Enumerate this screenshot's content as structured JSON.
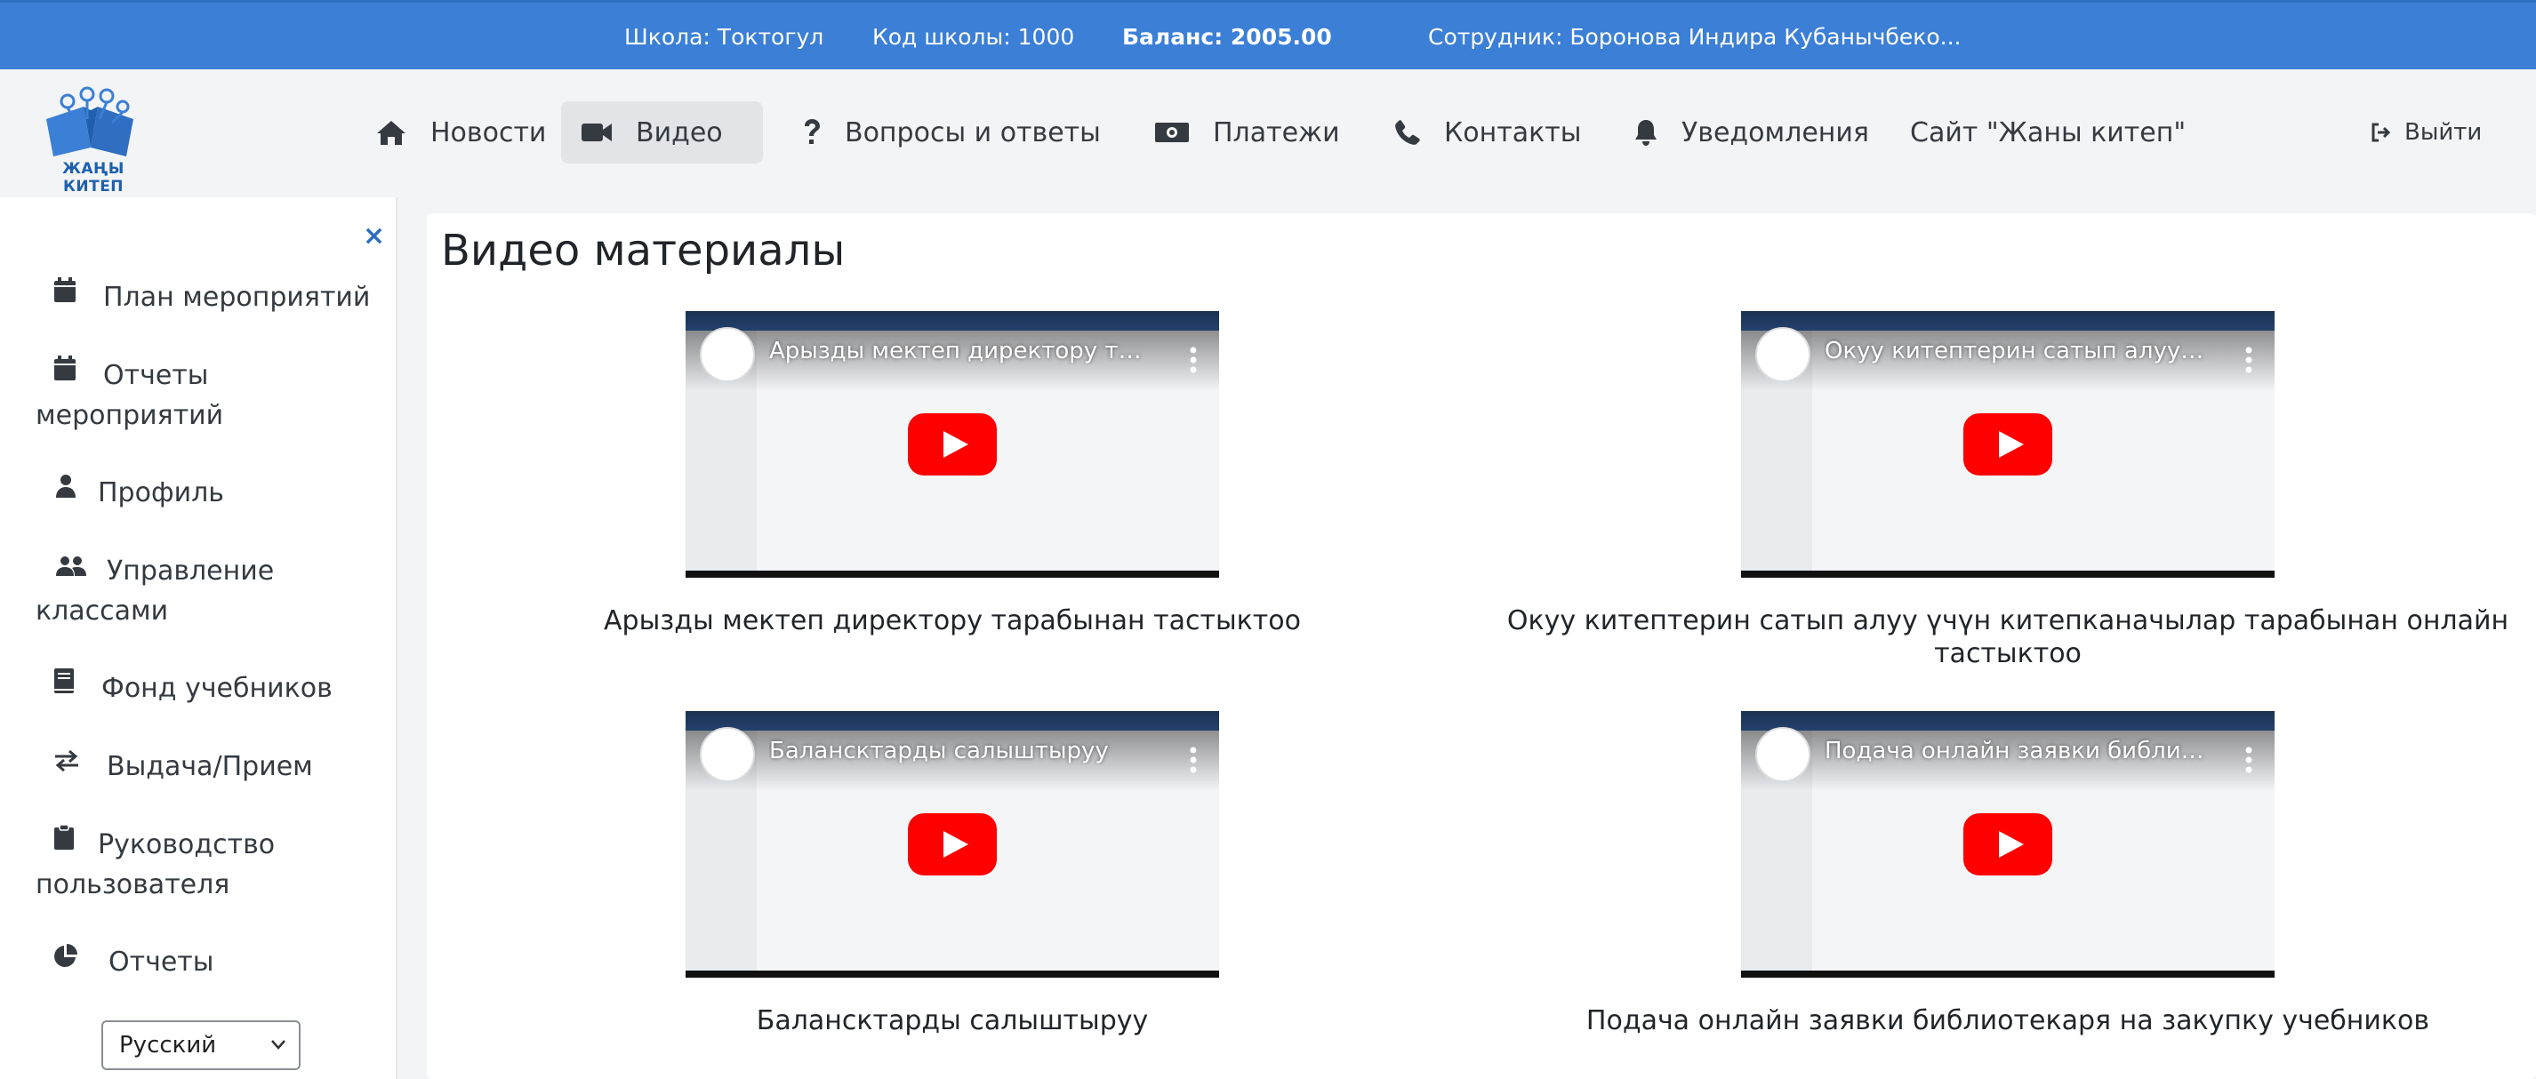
{
  "topbar": {
    "school": "Школа: Токтогул",
    "school_code": "Код школы: 1000",
    "balance": "Баланс: 2005.00",
    "employee": "Сотрудник: Боронова Индира Кубанычбеко..."
  },
  "logo": {
    "caption": "ЖАҢЫ КИТЕП"
  },
  "nav": {
    "items": [
      {
        "label": "Новости",
        "icon": "home-icon"
      },
      {
        "label": "Видео",
        "icon": "video-camera-icon",
        "active": true
      },
      {
        "label": "Вопросы и ответы",
        "icon": "question-icon"
      },
      {
        "label": "Платежи",
        "icon": "money-bill-icon"
      },
      {
        "label": "Контакты",
        "icon": "phone-icon"
      },
      {
        "label": "Уведомления",
        "icon": "bell-icon"
      },
      {
        "label": "Сайт \"Жаны китеп\""
      }
    ],
    "logout_label": "Выйти"
  },
  "sidebar": {
    "close_symbol": "×",
    "items": [
      {
        "label": "План мероприятий",
        "icon": "calendar-icon"
      },
      {
        "label": "Отчеты мероприятий",
        "icon": "calendar-icon"
      },
      {
        "label": "Профиль",
        "icon": "user-icon"
      },
      {
        "label": "Управление классами",
        "icon": "users-icon"
      },
      {
        "label": "Фонд учебников",
        "icon": "book-icon"
      },
      {
        "label": "Выдача/Прием",
        "icon": "exchange-icon"
      },
      {
        "label": "Руководство пользователя",
        "icon": "clipboard-icon"
      },
      {
        "label": "Отчеты",
        "icon": "pie-chart-icon"
      }
    ],
    "language": {
      "selected": "Русский"
    }
  },
  "main": {
    "title": "Видео материалы",
    "videos": [
      {
        "title": "Арызды мектеп директору тар...",
        "caption": "Арызды мектеп директору тарабынан тастыктоо"
      },
      {
        "title": "Окуу китептерин сатып алуу үч...",
        "caption": "Окуу китептерин сатып алуу үчүн китепканачылар тарабынан онлайн тастыктоо"
      },
      {
        "title": "Балансктарды салыштыруу",
        "caption": "Балансктарды салыштыруу"
      },
      {
        "title": "Подача онлайн заявки библиот...",
        "caption": "Подача онлайн заявки библиотекаря на закупку учебников"
      }
    ]
  },
  "colors": {
    "topbar": "#3b7fd6",
    "accent": "#2f6ec0",
    "youtube_red": "#ff0000"
  }
}
